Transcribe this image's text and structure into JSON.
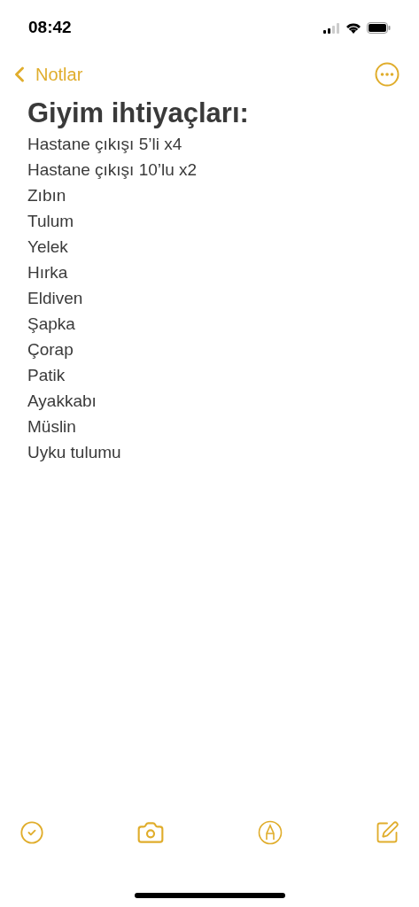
{
  "status_bar": {
    "time": "08:42"
  },
  "nav": {
    "back_label": "Notlar"
  },
  "note": {
    "title": "Giyim ihtiyaçları:",
    "lines": [
      "Hastane çıkışı 5’li x4",
      "Hastane çıkışı 10’lu x2",
      "Zıbın",
      "Tulum",
      "Yelek",
      "Hırka",
      "Eldiven",
      "Şapka",
      "Çorap",
      "Patik",
      "Ayakkabı",
      "Müslin",
      "Uyku tulumu"
    ]
  }
}
